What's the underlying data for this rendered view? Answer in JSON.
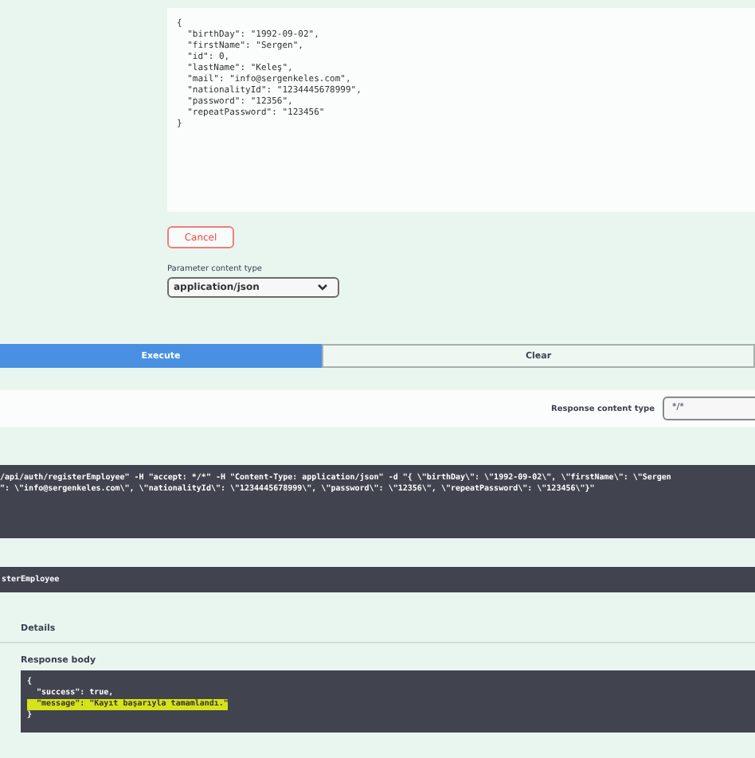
{
  "request_body": {
    "lines": [
      "{",
      "  \"birthDay\": \"1992-09-02\",",
      "  \"firstName\": \"Sergen\",",
      "  \"id\": 0,",
      "  \"lastName\": \"Keleş\",",
      "  \"mail\": \"info@sergenkeles.com\",",
      "  \"nationalityId\": \"1234445678999\",",
      "  \"password\": \"12356\",",
      "  \"repeatPassword\": \"123456\"",
      "}"
    ]
  },
  "cancel_button": "Cancel",
  "parameter_content_type": {
    "label": "Parameter content type",
    "value": "application/json"
  },
  "actions": [
    {
      "label": "Execute",
      "kind": "primary"
    },
    {
      "label": "Clear",
      "kind": "secondary"
    }
  ],
  "response_content_type": {
    "label": "Response content type",
    "value": "*/*"
  },
  "curl": {
    "lines": [
      "/api/auth/registerEmployee\" -H \"accept: */*\" -H \"Content-Type: application/json\" -d \"{ \\\"birthDay\\\": \\\"1992-09-02\\\", \\\"firstName\\\": \\\"Sergen",
      "\": \\\"info@sergenkeles.com\\\", \\\"nationalityId\\\": \\\"1234445678999\\\", \\\"password\\\": \\\"12356\\\", \\\"repeatPassword\\\": \\\"123456\\\"}\""
    ]
  },
  "request_url": "sterEmployee",
  "details_heading": "Details",
  "response_body": {
    "label": "Response body",
    "lines": [
      {
        "text": "{",
        "highlighted": false
      },
      {
        "text": "  \"success\": true,",
        "highlighted": false
      },
      {
        "text": "  \"message\": \"Kayıt başarıyla tamamlandı.\"",
        "highlighted": true
      },
      {
        "text": "}",
        "highlighted": false
      }
    ]
  }
}
